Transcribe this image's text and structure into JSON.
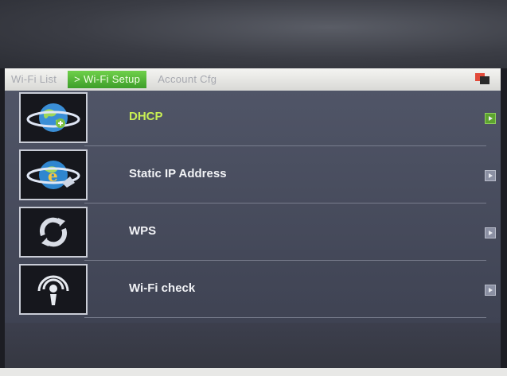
{
  "tabs": [
    {
      "label": "Wi-Fi List",
      "active": false
    },
    {
      "label": "> Wi-Fi Setup",
      "active": true
    },
    {
      "label": "Account Cfg",
      "active": false
    }
  ],
  "menu": {
    "items": [
      {
        "label": "DHCP",
        "icon": "globe-orbit-icon",
        "selected": true
      },
      {
        "label": "Static IP Address",
        "icon": "globe-ie-icon",
        "selected": false
      },
      {
        "label": "WPS",
        "icon": "refresh-circle-icon",
        "selected": false
      },
      {
        "label": "Wi-Fi check",
        "icon": "broadcast-icon",
        "selected": false
      }
    ]
  },
  "colors": {
    "selected_text": "#c8ef54",
    "active_tab": "#4fb53a",
    "menu_bg": "#4a4e5e"
  }
}
